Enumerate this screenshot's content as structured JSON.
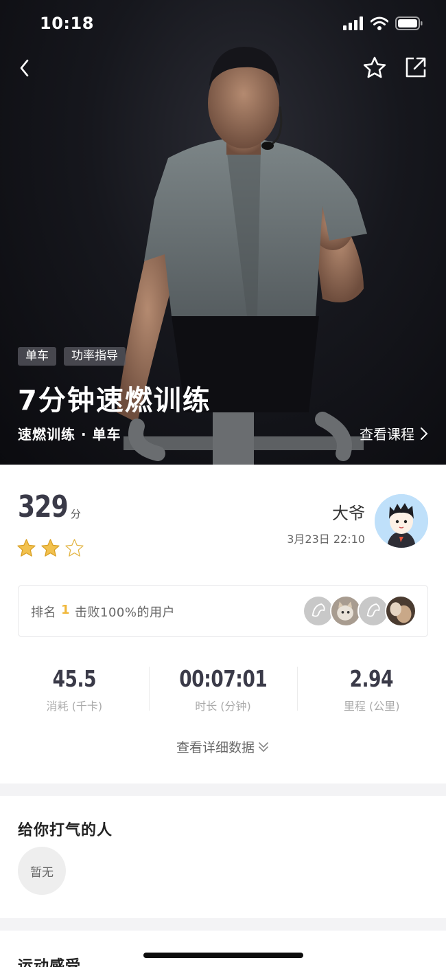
{
  "status_bar": {
    "time": "10:18"
  },
  "nav": {
    "back_icon": "chevron-left-icon",
    "favorite_icon": "star-outline-icon",
    "share_icon": "share-icon"
  },
  "hero": {
    "tags": [
      "单车",
      "功率指导"
    ],
    "title": "7分钟速燃训练",
    "subtitle": "速燃训练 · 单车",
    "view_course": "查看课程"
  },
  "score": {
    "value": "329",
    "unit": "分",
    "stars_filled": 2,
    "stars_total": 3
  },
  "user": {
    "name": "大爷",
    "date": "3月23日 22:10"
  },
  "rank": {
    "prefix": "排名",
    "position": "1",
    "suffix": "击败100%的用户"
  },
  "metrics": [
    {
      "value": "45.5",
      "label": "消耗 (千卡)"
    },
    {
      "value": "00:07:01",
      "label": "时长 (分钟)"
    },
    {
      "value": "2.94",
      "label": "里程 (公里)"
    }
  ],
  "detail_link": "查看详细数据",
  "cheer": {
    "title": "给你打气的人",
    "empty": "暂无"
  },
  "feeling": {
    "title": "运动感受"
  },
  "colors": {
    "accent_gold": "#f0b73a",
    "metric_text": "#3a3a48",
    "hero_bg": "#16171d"
  }
}
